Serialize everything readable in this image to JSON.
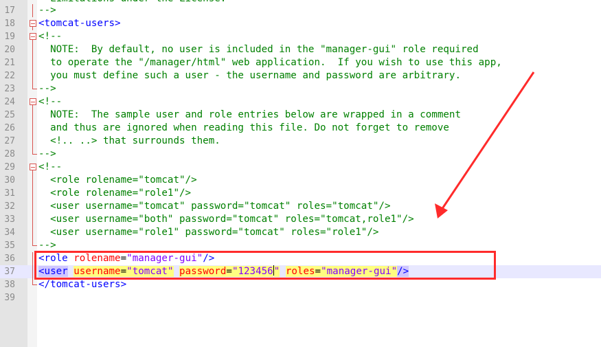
{
  "editor": {
    "lines": [
      {
        "num": "17",
        "text": "-->",
        "kind": "comment"
      },
      {
        "num": "18",
        "text": "<tomcat-users>",
        "kind": "tag"
      },
      {
        "num": "19",
        "text": "<!--",
        "kind": "comment"
      },
      {
        "num": "20",
        "text": "  NOTE:  By default, no user is included in the \"manager-gui\" role required",
        "kind": "comment"
      },
      {
        "num": "21",
        "text": "  to operate the \"/manager/html\" web application.  If you wish to use this app,",
        "kind": "comment"
      },
      {
        "num": "22",
        "text": "  you must define such a user - the username and password are arbitrary.",
        "kind": "comment"
      },
      {
        "num": "23",
        "text": "-->",
        "kind": "comment"
      },
      {
        "num": "24",
        "text": "<!--",
        "kind": "comment"
      },
      {
        "num": "25",
        "text": "  NOTE:  The sample user and role entries below are wrapped in a comment",
        "kind": "comment"
      },
      {
        "num": "26",
        "text": "  and thus are ignored when reading this file. Do not forget to remove",
        "kind": "comment"
      },
      {
        "num": "27",
        "text": "  <!.. ..> that surrounds them.",
        "kind": "comment"
      },
      {
        "num": "28",
        "text": "-->",
        "kind": "comment"
      },
      {
        "num": "29",
        "text": "<!--",
        "kind": "comment"
      },
      {
        "num": "30",
        "text": "  <role rolename=\"tomcat\"/>",
        "kind": "comment"
      },
      {
        "num": "31",
        "text": "  <role rolename=\"role1\"/>",
        "kind": "comment"
      },
      {
        "num": "32",
        "text": "  <user username=\"tomcat\" password=\"tomcat\" roles=\"tomcat\"/>",
        "kind": "comment"
      },
      {
        "num": "33",
        "text": "  <user username=\"both\" password=\"tomcat\" roles=\"tomcat,role1\"/>",
        "kind": "comment"
      },
      {
        "num": "34",
        "text": "  <user username=\"role1\" password=\"tomcat\" roles=\"role1\"/>",
        "kind": "comment"
      },
      {
        "num": "35",
        "text": "-->",
        "kind": "comment"
      },
      {
        "num": "36",
        "text": "<role rolename=\"manager-gui\"/>",
        "kind": "role"
      },
      {
        "num": "37",
        "text": "<user username=\"tomcat\" password=\"123456\" roles=\"manager-gui\"/>",
        "kind": "user"
      },
      {
        "num": "38",
        "text": "</tomcat-users>",
        "kind": "tag"
      },
      {
        "num": "39",
        "text": "",
        "kind": "empty"
      }
    ],
    "top_partial_text": "  Limitations under the License.",
    "role_line": {
      "open": "<role",
      "attr": "rolename",
      "eq": "=",
      "value": "\"manager-gui\"",
      "close": "/>"
    },
    "user_line": {
      "open": "<user",
      "attr1": "username",
      "val1": "\"tomcat\"",
      "attr2": "password",
      "val2a": "\"123456",
      "val2b": "\"",
      "attr3": "roles",
      "val3": "\"manager-gui\"",
      "close": "/>",
      "eq": "="
    },
    "colors": {
      "comment": "#008000",
      "tag": "#0000ff",
      "attribute": "#ff0000",
      "string": "#8000ff",
      "annotation": "#ff2b2b"
    }
  }
}
